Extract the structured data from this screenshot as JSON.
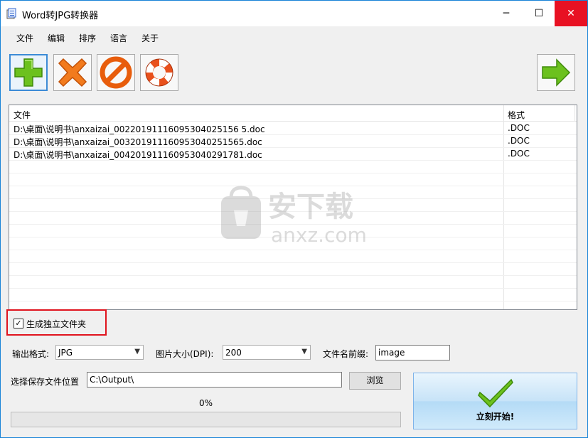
{
  "window": {
    "title": "Word转JPG转换器",
    "minimize_glyph": "─",
    "maximize_glyph": "☐",
    "close_glyph": "✕"
  },
  "menu": {
    "items": [
      {
        "label": "文件"
      },
      {
        "label": "编辑"
      },
      {
        "label": "排序"
      },
      {
        "label": "语言"
      },
      {
        "label": "关于"
      }
    ]
  },
  "toolbar": {
    "buttons": [
      {
        "icon": "add-icon",
        "color": "#6cc11e"
      },
      {
        "icon": "delete-icon",
        "color": "#f27b1d"
      },
      {
        "icon": "clear-icon",
        "color": "#e85d0c"
      },
      {
        "icon": "help-icon",
        "color": "#e8501c"
      },
      {
        "icon": "next-arrow-icon",
        "color": "#6cc11e"
      }
    ]
  },
  "file_list": {
    "columns": [
      "文件",
      "格式"
    ],
    "rows": [
      {
        "file": "D:\\桌面\\说明书\\anxaizai_00220191116095304025156 5.doc",
        "format": ".DOC"
      },
      {
        "file": "D:\\桌面\\说明书\\anxaizai_003201911160953040251565.doc",
        "format": ".DOC"
      },
      {
        "file": "D:\\桌面\\说明书\\anxaizai_004201911160953040291781.doc",
        "format": ".DOC"
      }
    ]
  },
  "options": {
    "separate_folder_label": "生成独立文件夹",
    "separate_folder_checked": true,
    "output_format_label": "输出格式:",
    "output_format_value": "JPG",
    "dpi_label": "图片大小(DPI):",
    "dpi_value": "200",
    "prefix_label": "文件名前缀:",
    "prefix_value": "image",
    "save_location_label": "选择保存文件位置",
    "save_location_value": "C:\\Output\\",
    "browse_label": "浏览"
  },
  "progress": {
    "percent_text": "0%",
    "value": 0
  },
  "start_button": {
    "label": "立刻开始!"
  },
  "watermark": {
    "text_cn": "安下载",
    "text_en": "anxz.com"
  },
  "colors": {
    "close_red": "#e81123",
    "highlight_red": "#e0141e",
    "accent_blue": "#1883d7"
  }
}
